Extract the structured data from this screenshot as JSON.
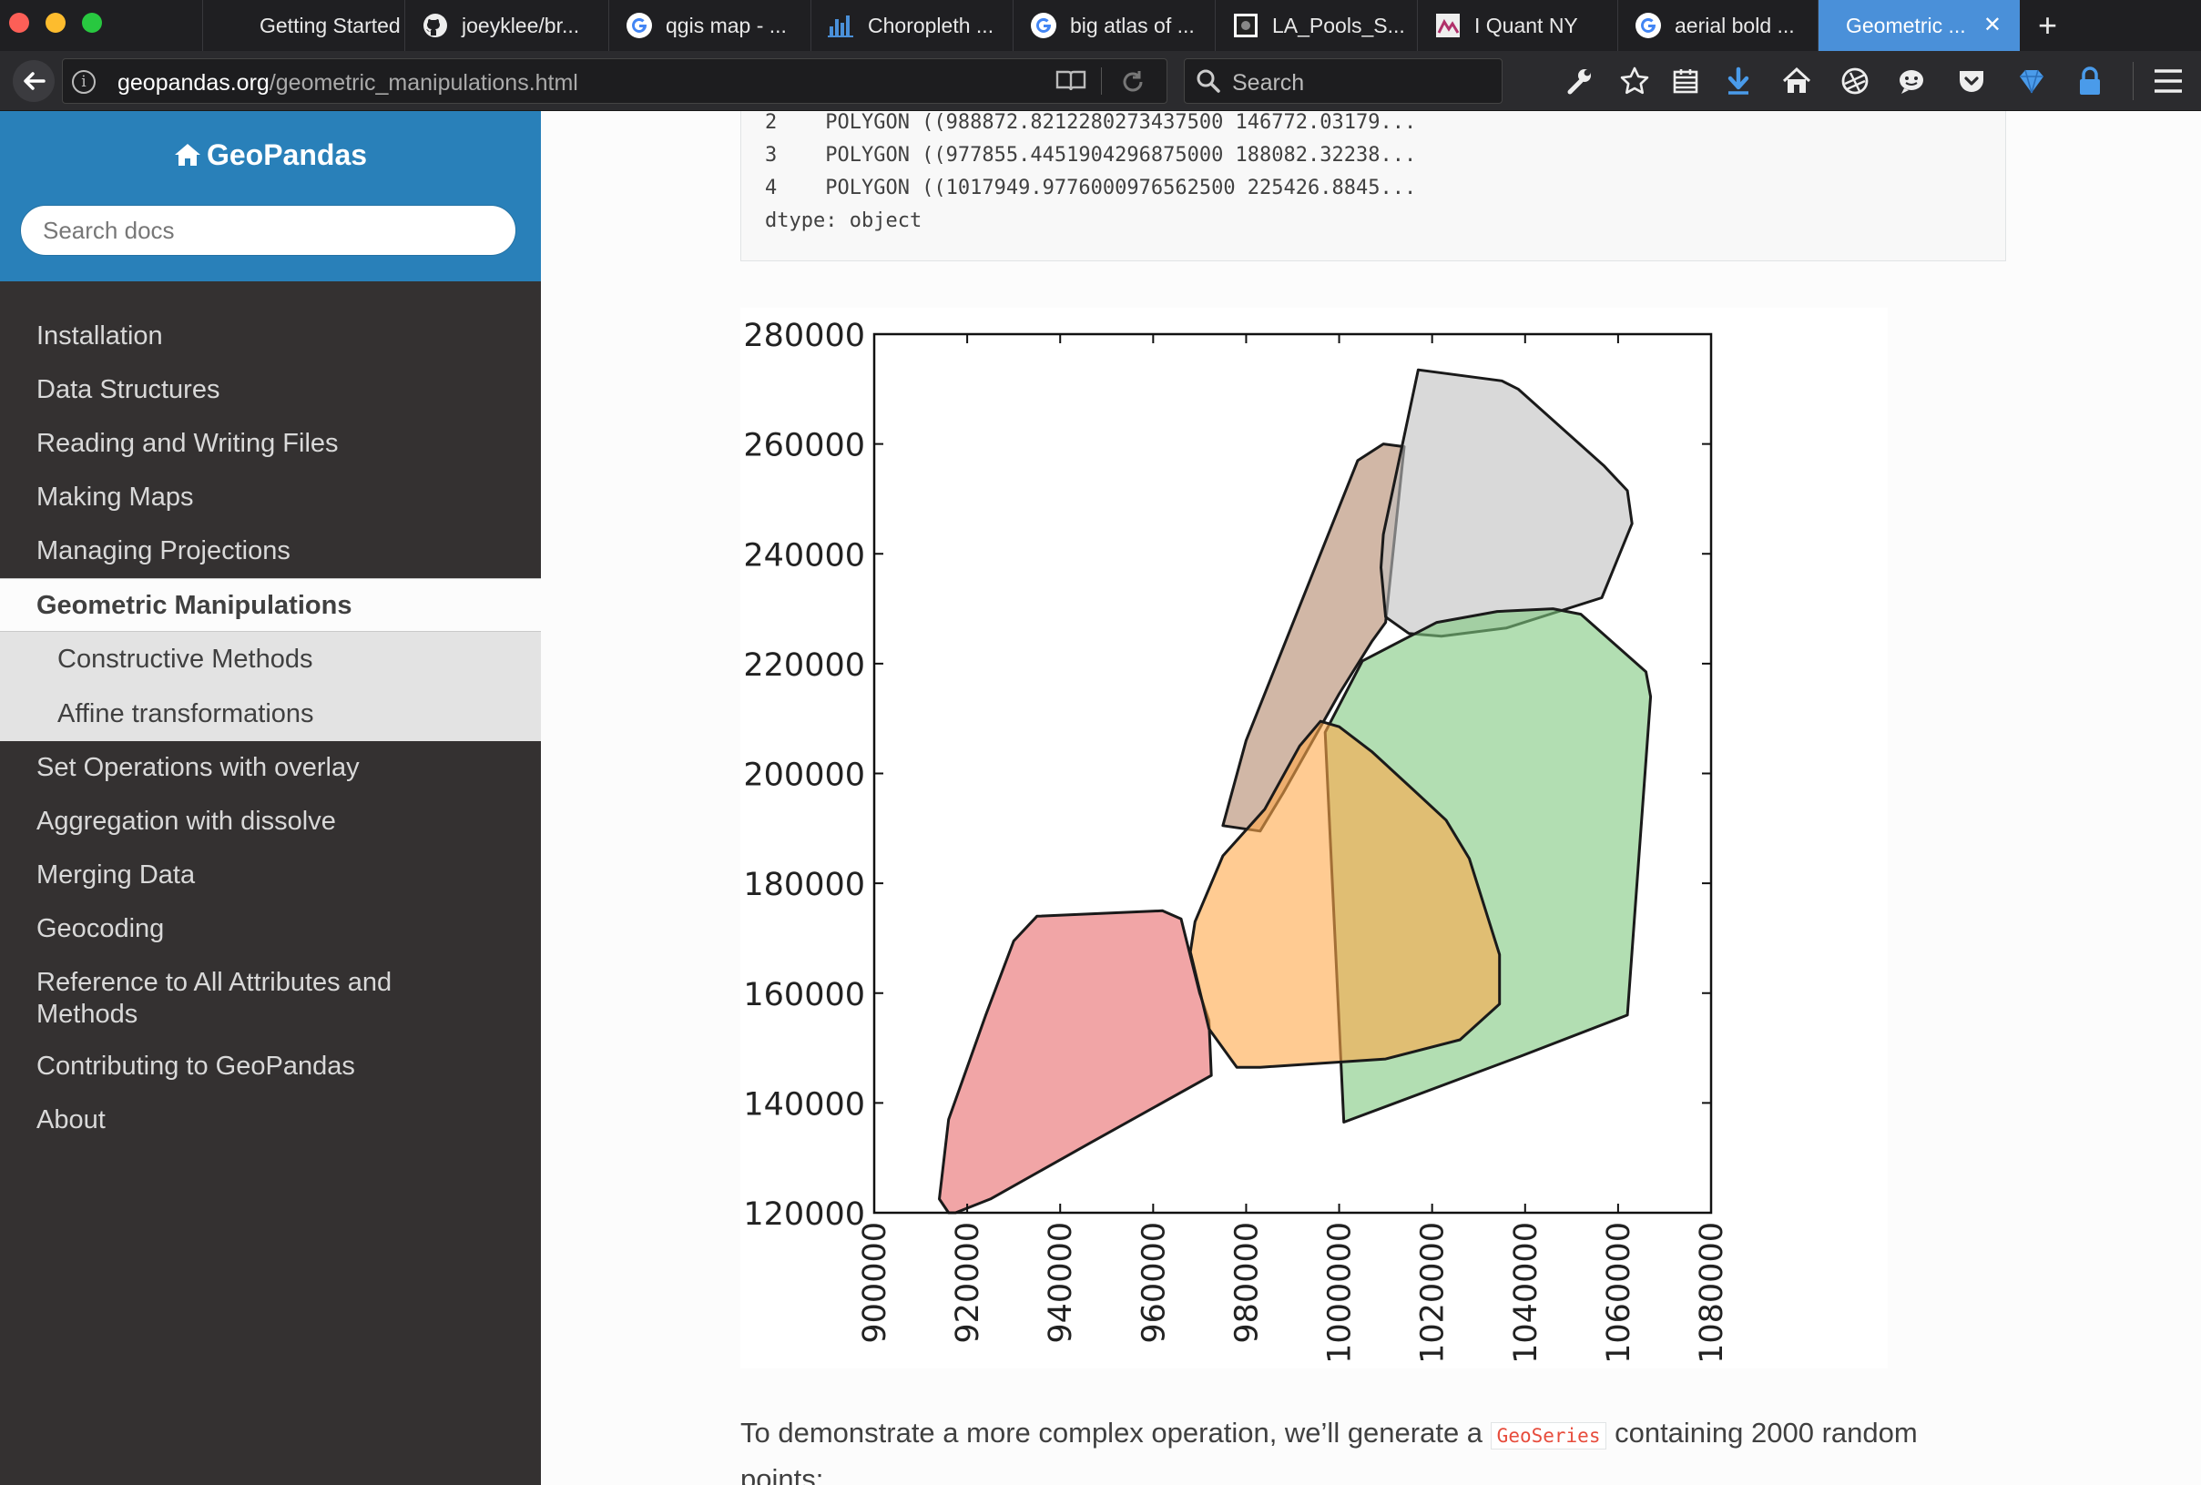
{
  "browser": {
    "tabs": [
      {
        "label": "Getting Started ...",
        "icon": "page-icon"
      },
      {
        "label": "joeyklee/br...",
        "icon": "github-icon"
      },
      {
        "label": "qgis map - ...",
        "icon": "google-icon"
      },
      {
        "label": "Choropleth ...",
        "icon": "chart-icon"
      },
      {
        "label": "big atlas of ...",
        "icon": "google-icon"
      },
      {
        "label": "LA_Pools_S...",
        "icon": "dark-square-icon"
      },
      {
        "label": "I Quant NY",
        "icon": "iquantny-icon"
      },
      {
        "label": "aerial bold ...",
        "icon": "google-icon"
      },
      {
        "label": "Geometric ...",
        "icon": "",
        "active": true
      }
    ],
    "url_host": "geopandas.org",
    "url_path": "/geometric_manipulations.html",
    "search_placeholder": "Search",
    "accent_color": "#4a90d9"
  },
  "sidebar": {
    "brand": "GeoPandas",
    "search_placeholder": "Search docs",
    "items": [
      {
        "label": "Installation"
      },
      {
        "label": "Data Structures"
      },
      {
        "label": "Reading and Writing Files"
      },
      {
        "label": "Making Maps"
      },
      {
        "label": "Managing Projections"
      },
      {
        "label": "Geometric Manipulations",
        "current": true
      },
      {
        "label": "Constructive Methods",
        "sub": true
      },
      {
        "label": "Affine transformations",
        "sub": true
      },
      {
        "label": "Set Operations with overlay"
      },
      {
        "label": "Aggregation with dissolve"
      },
      {
        "label": "Merging Data"
      },
      {
        "label": "Geocoding"
      },
      {
        "label": "Reference to All Attributes and Methods"
      },
      {
        "label": "Contributing to GeoPandas"
      },
      {
        "label": "About"
      }
    ],
    "header_color": "#2980b9",
    "bg_color": "#343131"
  },
  "main": {
    "code_lines": [
      "2    POLYGON ((988872.8212280273437500 146772.03179...",
      "3    POLYGON ((977855.4451904296875000 188082.32238...",
      "4    POLYGON ((1017949.9776000976562500 225426.8845...",
      "dtype: object"
    ],
    "paragraph_before": "To demonstrate a more complex operation, we’ll generate a ",
    "paragraph_code": "GeoSeries",
    "paragraph_after": " containing 2000 random",
    "paragraph_line2": "points:"
  },
  "chart_data": {
    "type": "polygon",
    "xlim": [
      900000,
      1080000
    ],
    "ylim": [
      120000,
      280000
    ],
    "xticks": [
      "900000",
      "920000",
      "940000",
      "960000",
      "980000",
      "1000000",
      "1020000",
      "1040000",
      "1060000",
      "1080000"
    ],
    "yticks": [
      "120000",
      "140000",
      "160000",
      "180000",
      "200000",
      "220000",
      "240000",
      "260000",
      "280000"
    ],
    "grid": false,
    "polygons": [
      {
        "color": "#e8696b",
        "points": [
          [
            916000,
            120000
          ],
          [
            914000,
            122500
          ],
          [
            916000,
            137000
          ],
          [
            924000,
            156000
          ],
          [
            930000,
            169500
          ],
          [
            935000,
            174000
          ],
          [
            962000,
            175000
          ],
          [
            966000,
            173500
          ],
          [
            970000,
            160000
          ],
          [
            972000,
            155000
          ],
          [
            972500,
            145000
          ],
          [
            946000,
            132500
          ],
          [
            925000,
            122500
          ],
          [
            917500,
            120000
          ]
        ]
      },
      {
        "color": "#b2876b",
        "points": [
          [
            1004000,
            257000
          ],
          [
            1009500,
            260000
          ],
          [
            1014000,
            259500
          ],
          [
            1010000,
            227500
          ],
          [
            1007000,
            224000
          ],
          [
            1000000,
            214500
          ],
          [
            988000,
            196500
          ],
          [
            983000,
            189500
          ],
          [
            975000,
            190500
          ],
          [
            980000,
            206000
          ]
        ]
      },
      {
        "color": "#bfbfbf",
        "points": [
          [
            1017000,
            273500
          ],
          [
            1035000,
            271500
          ],
          [
            1038500,
            270000
          ],
          [
            1057000,
            256000
          ],
          [
            1062000,
            251500
          ],
          [
            1063000,
            245500
          ],
          [
            1056500,
            232000
          ],
          [
            1036000,
            226500
          ],
          [
            1022000,
            225000
          ],
          [
            1015000,
            225500
          ],
          [
            1010000,
            228500
          ],
          [
            1009000,
            237500
          ],
          [
            1009500,
            243500
          ]
        ]
      },
      {
        "color": "#7ec87e",
        "points": [
          [
            1021000,
            227500
          ],
          [
            1034000,
            229500
          ],
          [
            1046000,
            230000
          ],
          [
            1052000,
            229000
          ],
          [
            1066000,
            218500
          ],
          [
            1067000,
            214000
          ],
          [
            1062000,
            156000
          ],
          [
            1039000,
            148500
          ],
          [
            1001000,
            136500
          ],
          [
            997000,
            207500
          ],
          [
            1005000,
            220500
          ]
        ]
      },
      {
        "color": "#ffa849",
        "points": [
          [
            984000,
            193500
          ],
          [
            991500,
            205000
          ],
          [
            996000,
            209500
          ],
          [
            1000000,
            208500
          ],
          [
            1007000,
            204000
          ],
          [
            1016000,
            197000
          ],
          [
            1023000,
            191500
          ],
          [
            1028000,
            184500
          ],
          [
            1034500,
            167000
          ],
          [
            1034500,
            158000
          ],
          [
            1026000,
            151500
          ],
          [
            1010000,
            148000
          ],
          [
            983000,
            146500
          ],
          [
            978000,
            146500
          ],
          [
            972000,
            153500
          ],
          [
            968000,
            167500
          ],
          [
            969000,
            173000
          ],
          [
            975000,
            185000
          ]
        ]
      }
    ]
  }
}
